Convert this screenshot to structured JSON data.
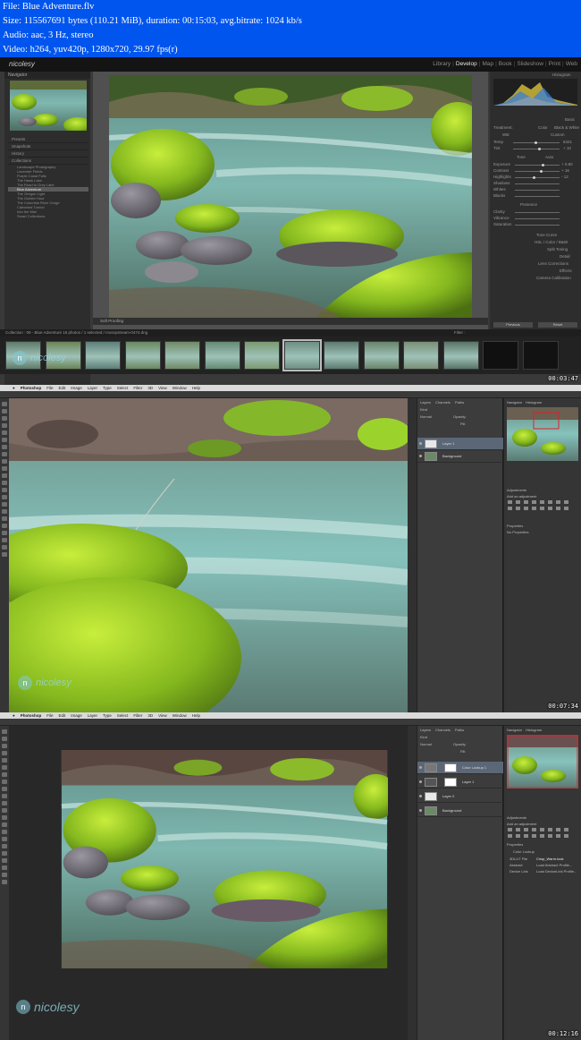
{
  "info": {
    "file": "File: Blue Adventure.flv",
    "size": "Size: 115567691 bytes (110.21 MiB), duration: 00:15:03, avg.bitrate: 1024 kb/s",
    "audio": "Audio: aac, 3 Hz, stereo",
    "video": "Video: h264, yuv420p, 1280x720, 29.97 fps(r)"
  },
  "frames": [
    {
      "app": "Lightroom",
      "timestamp": "00:03:47",
      "logo": "nicolesy",
      "modules": [
        "Library",
        "Develop",
        "Map",
        "Book",
        "Slideshow",
        "Print",
        "Web"
      ],
      "active_module": "Develop",
      "left_panel": {
        "navigator": "Navigator",
        "sections": [
          "Presets",
          "Snapshots",
          "History",
          "Collections"
        ],
        "collections": [
          "Landscape Photography",
          "Lavender Fields",
          "Purple Canal Falls",
          "The Hawk Lake",
          "The Road to Grey Lake",
          "Blue Adventure",
          "The Oregon Light",
          "The Golden Hour",
          "The Columbia River Gorge",
          "Cathedral Tunnel",
          "Into the Mist",
          "Smart Collections"
        ],
        "selected_collection": "Blue Adventure",
        "copy_button": "Copy...",
        "paste_button": "Paste"
      },
      "toolbar": "Soft Proofing",
      "right_panel": {
        "histogram": "Histogram",
        "basic": "Basic",
        "treatment": "Treatment:",
        "color": "Color",
        "bw": "Black & White",
        "wb": "WB:",
        "custom": "Custom",
        "temp": "Temp",
        "tint": "Tint",
        "temp_value": "5421",
        "tint_value": "+ 10",
        "tone": "Tone",
        "auto": "Auto",
        "exposure": "Exposure",
        "contrast": "Contrast",
        "highlights": "Highlights",
        "shadows": "Shadows",
        "whites": "Whites",
        "blacks": "Blacks",
        "exposure_value": "+ 0.80",
        "contrast_value": "+ 16",
        "highlights_value": "- 12",
        "presence": "Presence",
        "clarity": "Clarity",
        "vibrance": "Vibrance",
        "saturation": "Saturation",
        "panels": [
          "Tone Curve",
          "HSL / Color / B&W",
          "Split Toning",
          "Detail",
          "Lens Corrections",
          "Effects",
          "Camera Calibration"
        ],
        "previous_button": "Previous",
        "reset_button": "Reset"
      },
      "filmstrip_path": "Collection : 09 - Blue Adventure   15 photos / 1 selected / mossystream-0474.dng",
      "filter": "Filter :",
      "watermark": "nicolesy"
    },
    {
      "app": "Photoshop",
      "timestamp": "00:07:34",
      "menu": [
        "Photoshop",
        "File",
        "Edit",
        "Image",
        "Layer",
        "Type",
        "Select",
        "Filter",
        "3D",
        "View",
        "Window",
        "Help"
      ],
      "layers_tab": "Layers",
      "channels_tab": "Channels",
      "paths_tab": "Paths",
      "kind": "Kind",
      "normal": "Normal",
      "opacity": "Opacity:",
      "fill": "Fill:",
      "layers": [
        "Layer 1",
        "Background"
      ],
      "navigator": "Navigator",
      "histogram": "Histogram",
      "adjustments": "Adjustments",
      "add_adjustment": "Add an adjustment",
      "properties": "Properties",
      "no_properties": "No Properties",
      "watermark": "nicolesy"
    },
    {
      "app": "Photoshop",
      "timestamp": "00:12:16",
      "menu": [
        "Photoshop",
        "File",
        "Edit",
        "Image",
        "Layer",
        "Type",
        "Select",
        "Filter",
        "3D",
        "View",
        "Window",
        "Help"
      ],
      "layers_tab": "Layers",
      "channels_tab": "Channels",
      "paths_tab": "Paths",
      "kind": "Kind",
      "normal": "Normal",
      "opacity": "Opacity:",
      "fill": "Fill:",
      "layers": [
        "Color Lookup 1",
        "Layer 1",
        "Layer 2",
        "Background"
      ],
      "navigator": "Navigator",
      "histogram": "Histogram",
      "adjustments": "Adjustments",
      "add_adjustment": "Add an adjustment",
      "properties": "Properties",
      "color_lookup": "Color Lookup",
      "file_3dlut": "3DLUT File",
      "abstract": "Abstract",
      "device_link": "Device Link",
      "lut_value": "Crisp_Warm.look",
      "load_abstract": "Load Abstract Profile...",
      "load_device": "Load DeviceLink Profile...",
      "watermark": "nicolesy"
    }
  ]
}
